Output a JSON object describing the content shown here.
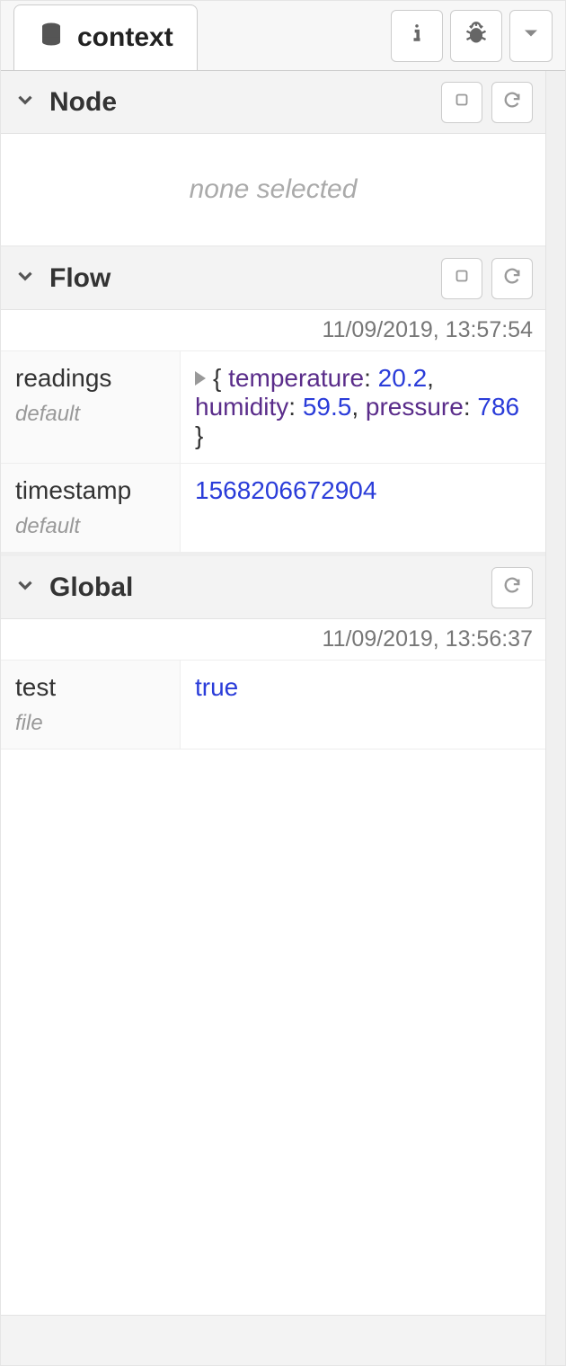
{
  "tab": {
    "label": "context"
  },
  "sections": {
    "node": {
      "title": "Node",
      "empty_text": "none selected"
    },
    "flow": {
      "title": "Flow",
      "timestamp": "11/09/2019, 13:57:54",
      "entries": [
        {
          "key": "readings",
          "store": "default",
          "object": {
            "temperature": 20.2,
            "humidity": 59.5,
            "pressure": 786
          }
        },
        {
          "key": "timestamp",
          "store": "default",
          "number": 1568206672904
        }
      ]
    },
    "global": {
      "title": "Global",
      "timestamp": "11/09/2019, 13:56:37",
      "entries": [
        {
          "key": "test",
          "store": "file",
          "bool": true
        }
      ]
    }
  }
}
